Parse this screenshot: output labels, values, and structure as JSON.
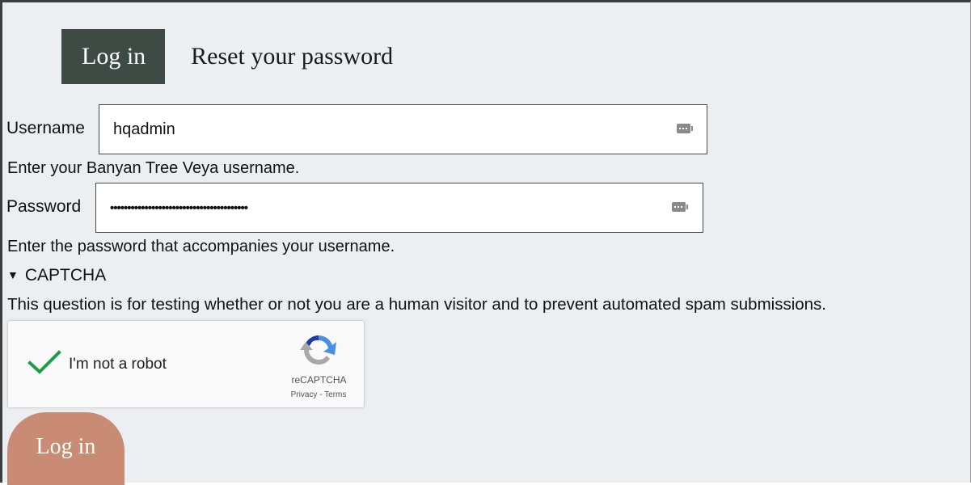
{
  "tabs": {
    "login": "Log in",
    "reset": "Reset your password"
  },
  "username": {
    "label": "Username",
    "value": "hqadmin",
    "help": "Enter your Banyan Tree Veya username."
  },
  "password": {
    "label": "Password",
    "value": "••••••••••••••••••••••••••••••••••••••••",
    "help": "Enter the password that accompanies your username."
  },
  "captcha": {
    "summary": "CAPTCHA",
    "description": "This question is for testing whether or not you are a human visitor and to prevent automated spam submissions.",
    "checkbox_label": "I'm not a robot",
    "brand": "reCAPTCHA",
    "privacy": "Privacy",
    "separator": " - ",
    "terms": "Terms",
    "checked": true
  },
  "submit": {
    "label": "Log in"
  },
  "colors": {
    "tab_active_bg": "#3d4b44",
    "page_bg": "#eceff2",
    "submit_bg": "#c98b73",
    "check_green": "#1e9d48"
  },
  "icons": {
    "credential_key": "password-manager-key-icon",
    "check": "checkmark-icon",
    "recaptcha": "recaptcha-logo-icon",
    "disclosure": "disclosure-triangle-icon"
  }
}
